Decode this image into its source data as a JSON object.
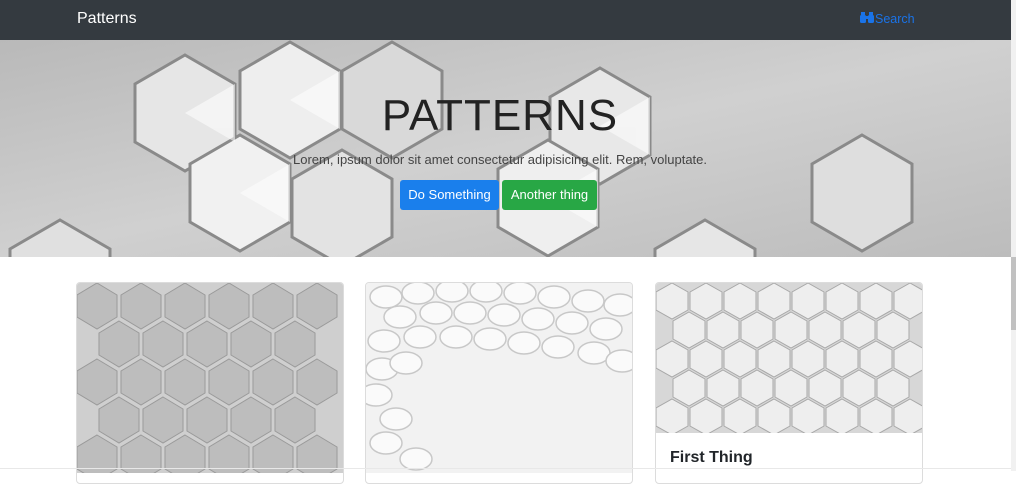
{
  "navbar": {
    "brand": "Patterns",
    "search_label": "Search",
    "search_icon": "binoculars-icon"
  },
  "hero": {
    "title": "PATTERNS",
    "lead": "Lorem, ipsum dolor sit amet consectetur adipisicing elit. Rem, voluptate.",
    "primary_button": "Do Something",
    "secondary_button": "Another thing"
  },
  "cards": [
    {
      "title": ""
    },
    {
      "title": ""
    },
    {
      "title": "First Thing"
    }
  ],
  "colors": {
    "navbar": "#343a40",
    "primary": "#1a7fec",
    "success": "#28a745",
    "search_link": "#1a73e8"
  }
}
